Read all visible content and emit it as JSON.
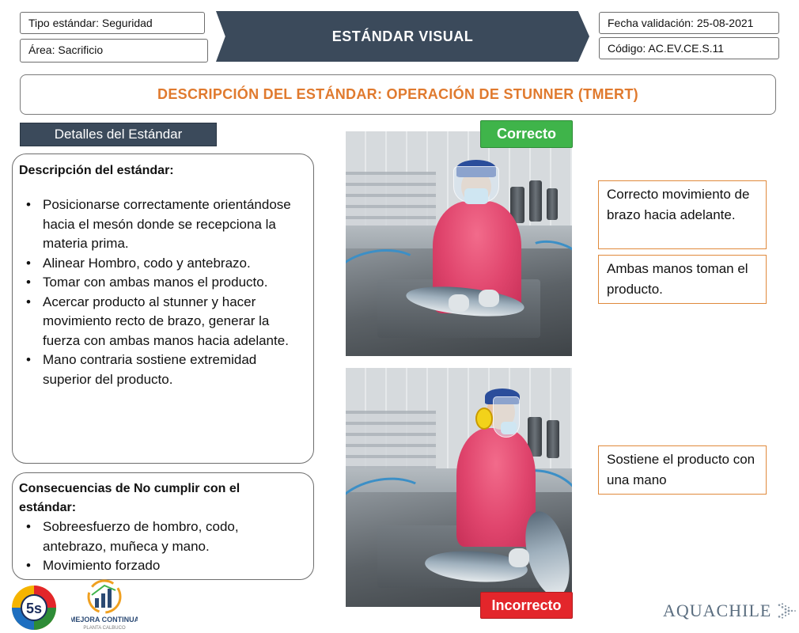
{
  "header": {
    "tipo_estandar": "Tipo estándar: Seguridad",
    "area": "Área: Sacrificio",
    "banner": "ESTÁNDAR VISUAL",
    "fecha_validacion": "Fecha validación: 25-08-2021",
    "codigo": "Código: AC.EV.CE.S.11"
  },
  "title": "DESCRIPCIÓN DEL ESTÁNDAR: OPERACIÓN DE STUNNER (TMERT)",
  "details_tab": "Detalles del Estándar",
  "description": {
    "heading": "Descripción del estándar:",
    "items": [
      "Posicionarse correctamente orientándose hacia el mesón donde se recepciona la materia prima.",
      "Alinear Hombro, codo y antebrazo.",
      "Tomar con ambas manos el producto.",
      "Acercar producto al stunner y hacer movimiento recto de brazo, generar la fuerza con ambas manos hacia adelante.",
      "Mano contraria sostiene extremidad superior del producto."
    ]
  },
  "consequences": {
    "heading": "Consecuencias de No cumplir con el estándar:",
    "items": [
      "Sobreesfuerzo de hombro, codo, antebrazo, muñeca y mano.",
      "Movimiento forzado"
    ]
  },
  "labels": {
    "correct": "Correcto",
    "incorrect": "Incorrecto"
  },
  "notes": {
    "correct_1": "Correcto movimiento de brazo hacia adelante.",
    "correct_2": "Ambas manos toman el producto.",
    "incorrect_1": "Sostiene el producto con una mano"
  },
  "logos": {
    "five_s": "5s",
    "mejora_title": "MEJORA CONTINUA",
    "mejora_sub": "PLANTA CALBUCO",
    "aquachile": "AquaChile"
  },
  "colors": {
    "banner": "#3b4a5b",
    "title_orange": "#e07a2e",
    "correct_green": "#3fb44a",
    "incorrect_red": "#e3262b",
    "note_border": "#e08a3c"
  },
  "icons": {
    "bullet": "bullet-dot-icon",
    "aquachile_mark": "chevron-arrows-icon"
  }
}
